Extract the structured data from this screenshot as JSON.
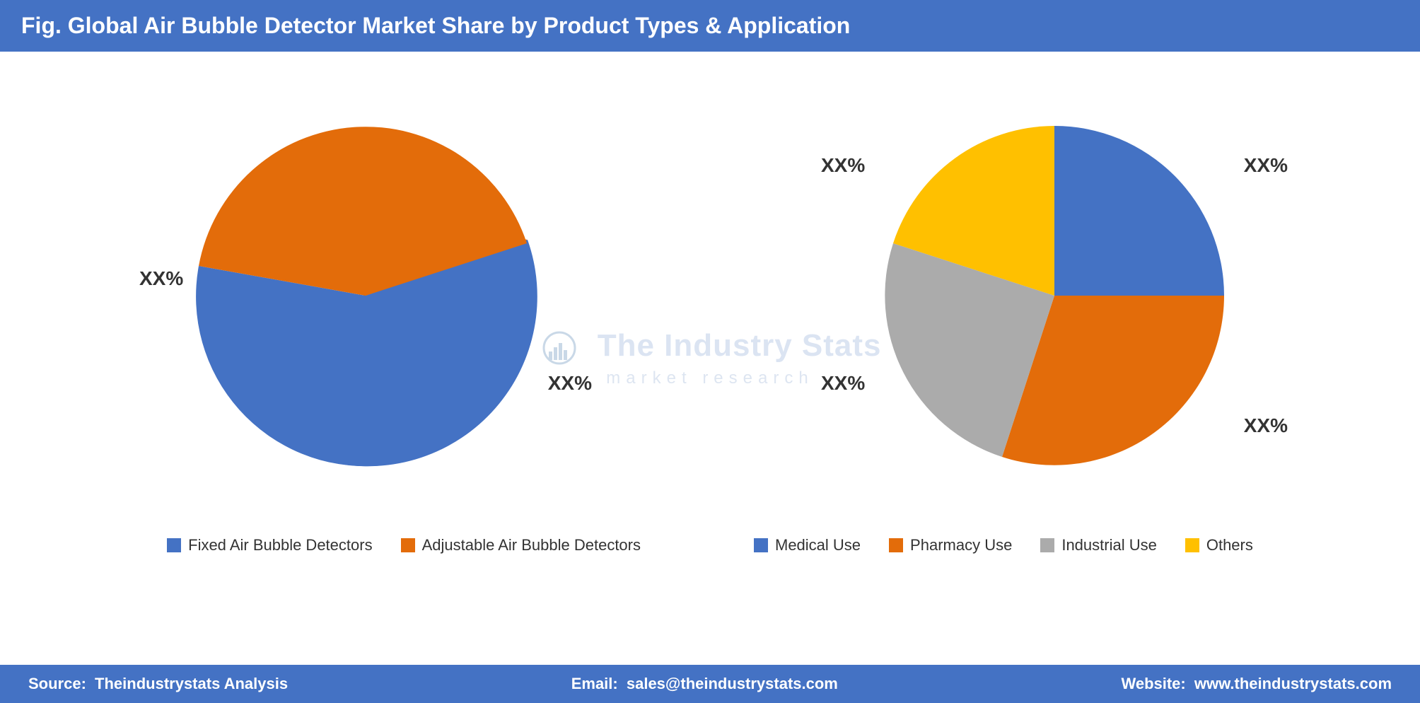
{
  "header": {
    "title": "Fig. Global Air Bubble Detector Market Share by Product Types & Application"
  },
  "left_chart": {
    "label_orange": "XX%",
    "label_blue": "XX%",
    "segments": [
      {
        "name": "Fixed Air Bubble Detectors",
        "color": "#4472C4",
        "percentage": 55
      },
      {
        "name": "Adjustable Air Bubble Detectors",
        "color": "#E36C0A",
        "percentage": 45
      }
    ]
  },
  "right_chart": {
    "label_top_left": "XX%",
    "label_top_right": "XX%",
    "label_bottom_left": "XX%",
    "label_bottom_right": "XX%",
    "segments": [
      {
        "name": "Medical Use",
        "color": "#4472C4",
        "percentage": 25
      },
      {
        "name": "Pharmacy Use",
        "color": "#E36C0A",
        "percentage": 30
      },
      {
        "name": "Industrial Use",
        "color": "#ABABAB",
        "percentage": 25
      },
      {
        "name": "Others",
        "color": "#FFC000",
        "percentage": 20
      }
    ]
  },
  "legend": {
    "left_items": [
      {
        "label": "Fixed Air Bubble Detectors",
        "color": "#4472C4"
      },
      {
        "label": "Adjustable Air Bubble Detectors",
        "color": "#E36C0A"
      }
    ],
    "right_items": [
      {
        "label": "Medical Use",
        "color": "#4472C4"
      },
      {
        "label": "Pharmacy Use",
        "color": "#E36C0A"
      },
      {
        "label": "Industrial Use",
        "color": "#ABABAB"
      },
      {
        "label": "Others",
        "color": "#FFC000"
      }
    ]
  },
  "watermark": {
    "line1": "The Industry Stats",
    "line2": "market research"
  },
  "footer": {
    "source_label": "Source:",
    "source_value": "Theindustrystats Analysis",
    "email_label": "Email:",
    "email_value": "sales@theindustrystats.com",
    "website_label": "Website:",
    "website_value": "www.theindustrystats.com"
  }
}
